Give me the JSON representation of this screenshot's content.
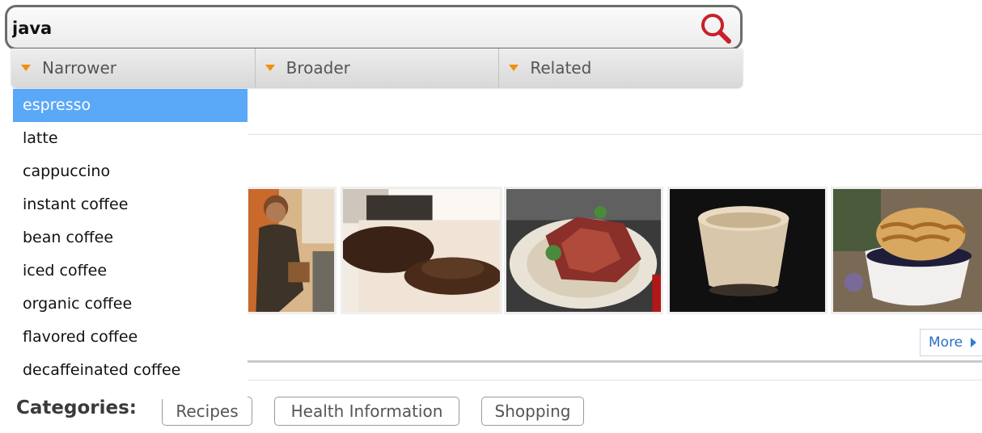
{
  "search": {
    "query": "java"
  },
  "tabs": [
    {
      "label": "Narrower"
    },
    {
      "label": "Broader"
    },
    {
      "label": "Related"
    }
  ],
  "dropdown": {
    "items": [
      {
        "label": "espresso",
        "selected": true
      },
      {
        "label": "latte"
      },
      {
        "label": "cappuccino"
      },
      {
        "label": "instant coffee"
      },
      {
        "label": "bean coffee"
      },
      {
        "label": "iced coffee"
      },
      {
        "label": "organic coffee"
      },
      {
        "label": "flavored coffee"
      },
      {
        "label": "decaffeinated coffee"
      }
    ]
  },
  "images": [
    {
      "icon": "person-with-coffee-photo"
    },
    {
      "icon": "coffee-beans-photo"
    },
    {
      "icon": "rack-of-lamb-photo"
    },
    {
      "icon": "iced-coffee-photo"
    },
    {
      "icon": "dessert-cup-photo"
    }
  ],
  "more": {
    "label": "More"
  },
  "categories": {
    "label": "Categories:",
    "items": [
      "Recipes",
      "Health Information",
      "Shopping"
    ]
  },
  "colors": {
    "selected_bg": "#5aa8f8",
    "tab_triangle": "#f0900c",
    "search_icon": "#c8202a",
    "more_text": "#2a6fc0"
  }
}
